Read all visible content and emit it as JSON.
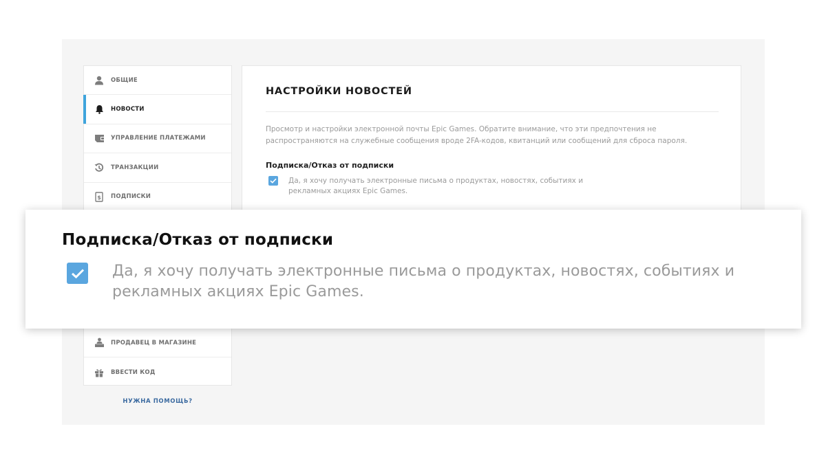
{
  "sidebar": {
    "items": [
      {
        "label": "ОБЩИЕ",
        "icon": "user-icon",
        "active": false
      },
      {
        "label": "НОВОСТИ",
        "icon": "bell-icon",
        "active": true
      },
      {
        "label": "УПРАВЛЕНИЕ ПЛАТЕЖАМИ",
        "icon": "wallet-icon",
        "active": false
      },
      {
        "label": "ТРАНЗАКЦИИ",
        "icon": "history-icon",
        "active": false
      },
      {
        "label": "ПОДПИСКИ",
        "icon": "subscription-icon",
        "active": false
      }
    ],
    "bottom_items": [
      {
        "label": "ПРОДАВЕЦ В МАГАЗИНЕ",
        "icon": "seller-icon"
      },
      {
        "label": "ВВЕСТИ КОД",
        "icon": "gift-icon"
      }
    ],
    "help_link": "НУЖНА ПОМОЩЬ?",
    "accent_color": "#3fa4dc"
  },
  "content": {
    "title": "НАСТРОЙКИ НОВОСТЕЙ",
    "description": "Просмотр и настройки электронной почты Epic Games. Обратите внимание, что эти предпочтения не распространяются на служебные сообщения вроде 2FA-кодов, квитанций или сообщений для сброса пароля.",
    "subscription_title": "Подписка/Отказ от подписки",
    "checkbox_label": "Да, я хочу получать электронные письма о продуктах, новостях, событиях и рекламных акциях Epic Games.",
    "checkbox_checked": true,
    "checkbox_color": "#5aa6df"
  },
  "zoom": {
    "title": "Подписка/Отказ от подписки",
    "checkbox_label": "Да, я хочу получать электронные письма о продуктах, новостях, событиях и рекламных акциях Epic Games."
  }
}
